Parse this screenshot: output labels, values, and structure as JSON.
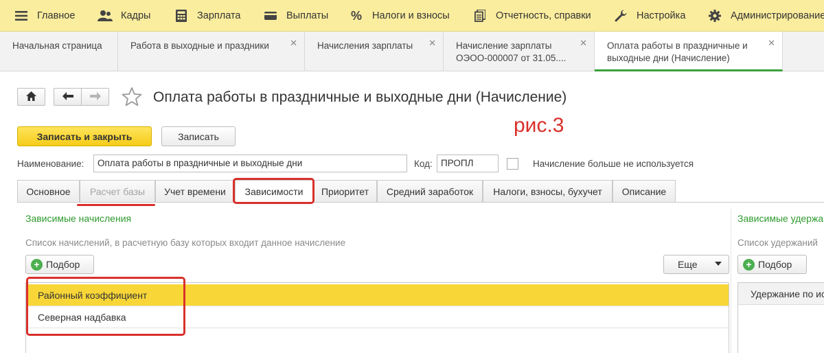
{
  "menu": {
    "items": [
      {
        "label": "Главное",
        "icon": "hamburger-icon"
      },
      {
        "label": "Кадры",
        "icon": "people-icon"
      },
      {
        "label": "Зарплата",
        "icon": "calculator-icon"
      },
      {
        "label": "Выплаты",
        "icon": "wallet-icon"
      },
      {
        "label": "Налоги и взносы",
        "icon": "percent-icon"
      },
      {
        "label": "Отчетность, справки",
        "icon": "documents-icon"
      },
      {
        "label": "Настройка",
        "icon": "wrench-icon"
      },
      {
        "label": "Администрирование",
        "icon": "gear-icon"
      }
    ]
  },
  "window_tabs": [
    {
      "line1": "Начальная страница",
      "line2": "",
      "closable": false
    },
    {
      "line1": "Работа в выходные и праздники",
      "line2": "",
      "closable": true
    },
    {
      "line1": "Начисления зарплаты",
      "line2": "",
      "closable": true
    },
    {
      "line1": "Начисление зарплаты",
      "line2": "ОЭОО-000007 от 31.05....",
      "closable": true
    },
    {
      "line1": "Оплата работы в праздничные и",
      "line2": "выходные дни (Начисление)",
      "closable": true
    }
  ],
  "form": {
    "title": "Оплата работы в праздничные и выходные дни (Начисление)",
    "annotation": "рис.3",
    "save_close_label": "Записать и закрыть",
    "save_label": "Записать",
    "name_label": "Наименование:",
    "name_value": "Оплата работы в праздничные и выходные дни",
    "code_label": "Код:",
    "code_value": "ПРОПЛ",
    "unused_label": "Начисление больше не используется"
  },
  "tabs": [
    {
      "label": "Основное"
    },
    {
      "label": "Расчет базы"
    },
    {
      "label": "Учет времени"
    },
    {
      "label": "Зависимости"
    },
    {
      "label": "Приоритет"
    },
    {
      "label": "Средний заработок"
    },
    {
      "label": "Налоги, взносы, бухучет"
    },
    {
      "label": "Описание"
    }
  ],
  "dependent_accruals": {
    "title": "Зависимые начисления",
    "hint": "Список начислений, в расчетную базу которых входит данное начисление",
    "pick_label": "Подбор",
    "more_label": "Еще",
    "rows": [
      "Районный коэффициент",
      "Северная надбавка"
    ]
  },
  "dependent_deductions": {
    "title": "Зависимые удержания",
    "hint": "Список удержаний",
    "pick_label": "Подбор",
    "row": "Удержание по исполнительному"
  }
}
